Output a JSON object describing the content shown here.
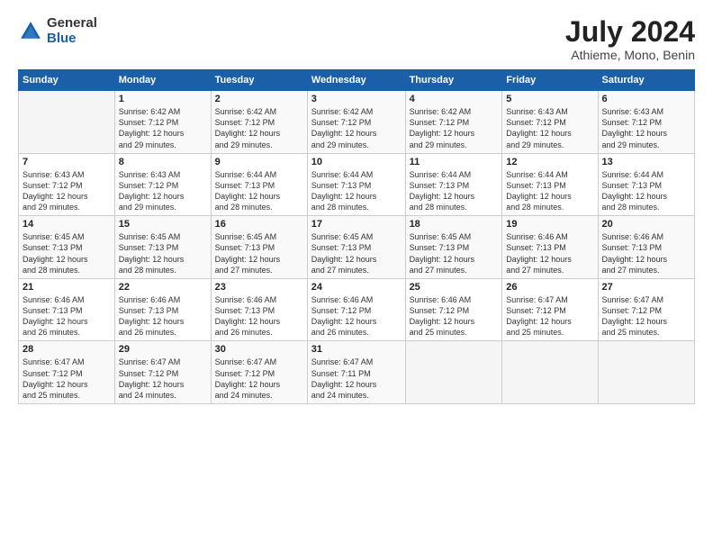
{
  "logo": {
    "general": "General",
    "blue": "Blue"
  },
  "title": "July 2024",
  "subtitle": "Athieme, Mono, Benin",
  "header_days": [
    "Sunday",
    "Monday",
    "Tuesday",
    "Wednesday",
    "Thursday",
    "Friday",
    "Saturday"
  ],
  "weeks": [
    [
      {
        "day": "",
        "info": ""
      },
      {
        "day": "1",
        "info": "Sunrise: 6:42 AM\nSunset: 7:12 PM\nDaylight: 12 hours\nand 29 minutes."
      },
      {
        "day": "2",
        "info": "Sunrise: 6:42 AM\nSunset: 7:12 PM\nDaylight: 12 hours\nand 29 minutes."
      },
      {
        "day": "3",
        "info": "Sunrise: 6:42 AM\nSunset: 7:12 PM\nDaylight: 12 hours\nand 29 minutes."
      },
      {
        "day": "4",
        "info": "Sunrise: 6:42 AM\nSunset: 7:12 PM\nDaylight: 12 hours\nand 29 minutes."
      },
      {
        "day": "5",
        "info": "Sunrise: 6:43 AM\nSunset: 7:12 PM\nDaylight: 12 hours\nand 29 minutes."
      },
      {
        "day": "6",
        "info": "Sunrise: 6:43 AM\nSunset: 7:12 PM\nDaylight: 12 hours\nand 29 minutes."
      }
    ],
    [
      {
        "day": "7",
        "info": "Sunrise: 6:43 AM\nSunset: 7:12 PM\nDaylight: 12 hours\nand 29 minutes."
      },
      {
        "day": "8",
        "info": "Sunrise: 6:43 AM\nSunset: 7:12 PM\nDaylight: 12 hours\nand 29 minutes."
      },
      {
        "day": "9",
        "info": "Sunrise: 6:44 AM\nSunset: 7:13 PM\nDaylight: 12 hours\nand 28 minutes."
      },
      {
        "day": "10",
        "info": "Sunrise: 6:44 AM\nSunset: 7:13 PM\nDaylight: 12 hours\nand 28 minutes."
      },
      {
        "day": "11",
        "info": "Sunrise: 6:44 AM\nSunset: 7:13 PM\nDaylight: 12 hours\nand 28 minutes."
      },
      {
        "day": "12",
        "info": "Sunrise: 6:44 AM\nSunset: 7:13 PM\nDaylight: 12 hours\nand 28 minutes."
      },
      {
        "day": "13",
        "info": "Sunrise: 6:44 AM\nSunset: 7:13 PM\nDaylight: 12 hours\nand 28 minutes."
      }
    ],
    [
      {
        "day": "14",
        "info": "Sunrise: 6:45 AM\nSunset: 7:13 PM\nDaylight: 12 hours\nand 28 minutes."
      },
      {
        "day": "15",
        "info": "Sunrise: 6:45 AM\nSunset: 7:13 PM\nDaylight: 12 hours\nand 28 minutes."
      },
      {
        "day": "16",
        "info": "Sunrise: 6:45 AM\nSunset: 7:13 PM\nDaylight: 12 hours\nand 27 minutes."
      },
      {
        "day": "17",
        "info": "Sunrise: 6:45 AM\nSunset: 7:13 PM\nDaylight: 12 hours\nand 27 minutes."
      },
      {
        "day": "18",
        "info": "Sunrise: 6:45 AM\nSunset: 7:13 PM\nDaylight: 12 hours\nand 27 minutes."
      },
      {
        "day": "19",
        "info": "Sunrise: 6:46 AM\nSunset: 7:13 PM\nDaylight: 12 hours\nand 27 minutes."
      },
      {
        "day": "20",
        "info": "Sunrise: 6:46 AM\nSunset: 7:13 PM\nDaylight: 12 hours\nand 27 minutes."
      }
    ],
    [
      {
        "day": "21",
        "info": "Sunrise: 6:46 AM\nSunset: 7:13 PM\nDaylight: 12 hours\nand 26 minutes."
      },
      {
        "day": "22",
        "info": "Sunrise: 6:46 AM\nSunset: 7:13 PM\nDaylight: 12 hours\nand 26 minutes."
      },
      {
        "day": "23",
        "info": "Sunrise: 6:46 AM\nSunset: 7:13 PM\nDaylight: 12 hours\nand 26 minutes."
      },
      {
        "day": "24",
        "info": "Sunrise: 6:46 AM\nSunset: 7:12 PM\nDaylight: 12 hours\nand 26 minutes."
      },
      {
        "day": "25",
        "info": "Sunrise: 6:46 AM\nSunset: 7:12 PM\nDaylight: 12 hours\nand 25 minutes."
      },
      {
        "day": "26",
        "info": "Sunrise: 6:47 AM\nSunset: 7:12 PM\nDaylight: 12 hours\nand 25 minutes."
      },
      {
        "day": "27",
        "info": "Sunrise: 6:47 AM\nSunset: 7:12 PM\nDaylight: 12 hours\nand 25 minutes."
      }
    ],
    [
      {
        "day": "28",
        "info": "Sunrise: 6:47 AM\nSunset: 7:12 PM\nDaylight: 12 hours\nand 25 minutes."
      },
      {
        "day": "29",
        "info": "Sunrise: 6:47 AM\nSunset: 7:12 PM\nDaylight: 12 hours\nand 24 minutes."
      },
      {
        "day": "30",
        "info": "Sunrise: 6:47 AM\nSunset: 7:12 PM\nDaylight: 12 hours\nand 24 minutes."
      },
      {
        "day": "31",
        "info": "Sunrise: 6:47 AM\nSunset: 7:11 PM\nDaylight: 12 hours\nand 24 minutes."
      },
      {
        "day": "",
        "info": ""
      },
      {
        "day": "",
        "info": ""
      },
      {
        "day": "",
        "info": ""
      }
    ]
  ]
}
